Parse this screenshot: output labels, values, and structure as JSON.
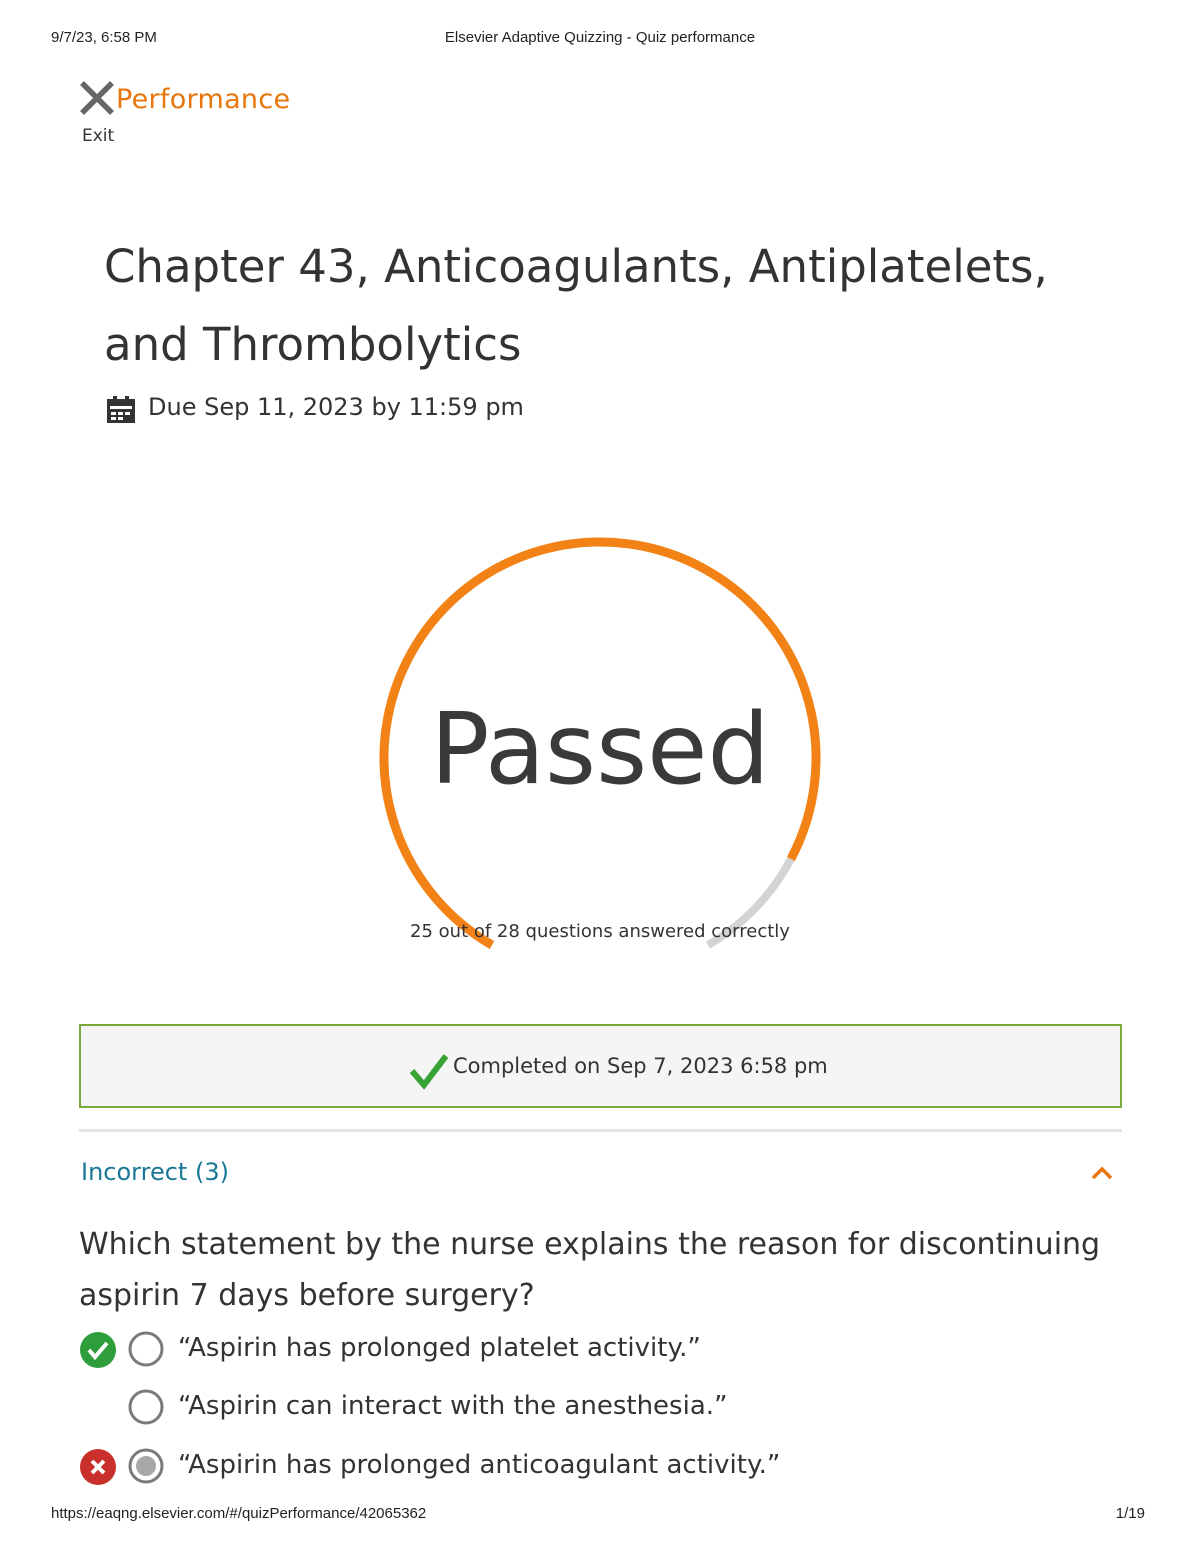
{
  "print_header": {
    "datetime": "9/7/23, 6:58 PM",
    "title": "Elsevier Adaptive Quizzing - Quiz performance"
  },
  "topbar": {
    "heading": "Performance",
    "exit_label": "Exit",
    "exit_icon": "close-x-icon"
  },
  "quiz": {
    "title": "Chapter 43, Anticoagulants, Antiplatelets, and Thrombolytics",
    "due_text": "Due Sep 11, 2023 by 11:59 pm",
    "due_icon": "calendar-icon"
  },
  "result": {
    "status": "Passed",
    "correct": 25,
    "total": 28,
    "score_text": "25 out of 28 questions answered correctly",
    "progress_color": "#f28215",
    "track_color": "#d3d3d3"
  },
  "completion": {
    "text": "Completed on Sep 7, 2023 6:58 pm",
    "icon": "checkmark-icon",
    "border_color": "#7aa83b"
  },
  "section": {
    "title": "Incorrect (3)",
    "expanded": true,
    "accent_color": "#1a7896"
  },
  "question": {
    "text": "Which statement by the nurse explains the reason for discontinuing aspirin 7 days before surgery?",
    "answers": [
      {
        "text": "“Aspirin has prolonged platelet activity.”",
        "mark": "correct",
        "selected": false
      },
      {
        "text": "“Aspirin can interact with the anesthesia.”",
        "mark": "none",
        "selected": false
      },
      {
        "text": "“Aspirin has prolonged anticoagulant activity.”",
        "mark": "incorrect",
        "selected": true
      }
    ]
  },
  "print_footer": {
    "url": "https://eaqng.elsevier.com/#/quizPerformance/42065362",
    "page": "1/19"
  }
}
